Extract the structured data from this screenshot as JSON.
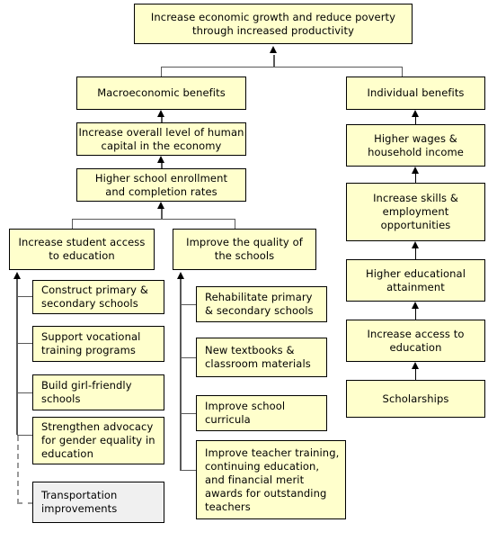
{
  "diagram": {
    "title": "Education program results chain",
    "colors": {
      "box_fill": "#ffffcc",
      "box_fill_inactive": "#f0f0f0",
      "box_border": "#000000",
      "connector": "#595959",
      "dashed_connector": "#9a9a9a",
      "background": "#ffffff"
    },
    "nodes": {
      "goal": "Increase economic growth and reduce poverty\nthrough increased productivity",
      "macro_benefits": "Macroeconomic benefits",
      "individual_benefits": "Individual benefits",
      "human_capital": "Increase overall level of human\ncapital in the economy",
      "enrollment": "Higher school enrollment\nand completion rates",
      "student_access": "Increase student access\nto education",
      "quality_schools": "Improve the quality of\nthe schools",
      "higher_wages": "Higher wages &\nhousehold income",
      "skills_employment": "Increase skills &\nemployment\nopportunities",
      "educational_attainment": "Higher educational\nattainment",
      "access_education": "Increase access to\neducation",
      "scholarships": "Scholarships",
      "construct_schools": "Construct primary &\nsecondary schools",
      "vocational": "Support vocational\ntraining programs",
      "girl_friendly": "Build girl-friendly\nschools",
      "advocacy": "Strengthen advocacy\nfor gender equality in\neducation",
      "transportation": "Transportation\nimprovements",
      "rehabilitate": "Rehabilitate primary\n& secondary schools",
      "textbooks": "New textbooks &\nclassroom materials",
      "curricula": "Improve school\ncurricula",
      "teacher_training": "Improve teacher training,\ncontinuing education,\nand financial merit\nawards for outstanding\nteachers"
    }
  }
}
